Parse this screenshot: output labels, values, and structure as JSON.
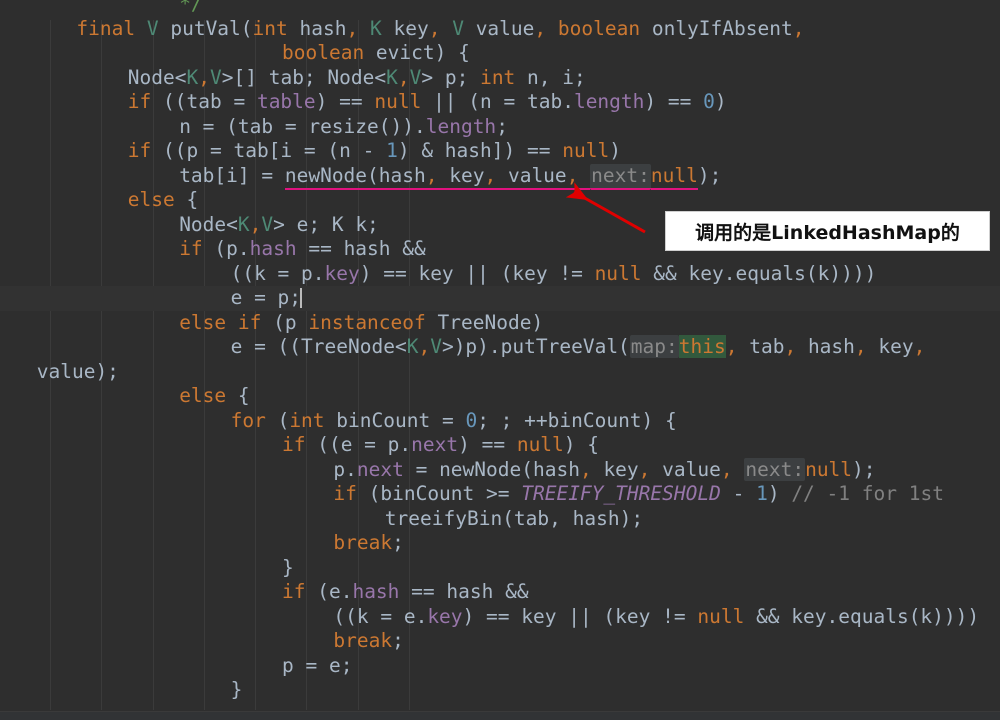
{
  "editor": {
    "language": "java",
    "theme": "darcula",
    "colors": {
      "background": "#2e2e2e",
      "foreground": "#a9b7c6",
      "keyword": "#cc7832",
      "number": "#6897bb",
      "field": "#9876aa",
      "generic_type": "#4e8975",
      "javadoc_comment": "#629755",
      "line_comment": "#808080",
      "inlay_hint_bg": "#3c3f41",
      "inlay_hint_fg": "#8a8a8a",
      "search_highlight_bg": "#32593d",
      "error_underline": "#e0127f",
      "current_line_bg": "#323232",
      "indent_guide": "#3b3b3b",
      "caret": "#bbbbbb"
    },
    "caret_line_index": 11,
    "lines": [
      {
        "indent": 3,
        "tokens": [
          {
            "t": "*/",
            "c": "cmt"
          }
        ]
      },
      {
        "indent": 1,
        "tokens": [
          {
            "t": "final",
            "c": "kw"
          },
          {
            "t": " ",
            "c": "pln"
          },
          {
            "t": "V",
            "c": "gen"
          },
          {
            "t": " ",
            "c": "pln"
          },
          {
            "t": "putVal",
            "c": "mth"
          },
          {
            "t": "(",
            "c": "punc"
          },
          {
            "t": "int",
            "c": "kw"
          },
          {
            "t": " hash",
            "c": "pln"
          },
          {
            "t": ",",
            "c": "comma"
          },
          {
            "t": " ",
            "c": "pln"
          },
          {
            "t": "K",
            "c": "gen"
          },
          {
            "t": " key",
            "c": "pln"
          },
          {
            "t": ",",
            "c": "comma"
          },
          {
            "t": " ",
            "c": "pln"
          },
          {
            "t": "V",
            "c": "gen"
          },
          {
            "t": " value",
            "c": "pln"
          },
          {
            "t": ",",
            "c": "comma"
          },
          {
            "t": " ",
            "c": "pln"
          },
          {
            "t": "boolean",
            "c": "kw"
          },
          {
            "t": " onlyIfAbsent",
            "c": "pln"
          },
          {
            "t": ",",
            "c": "comma"
          }
        ]
      },
      {
        "indent": 5,
        "tokens": [
          {
            "t": "boolean",
            "c": "kw"
          },
          {
            "t": " evict",
            "c": "pln"
          },
          {
            "t": ") {",
            "c": "punc"
          }
        ]
      },
      {
        "indent": 2,
        "tokens": [
          {
            "t": "Node<",
            "c": "typ"
          },
          {
            "t": "K",
            "c": "gen"
          },
          {
            "t": ",",
            "c": "comma"
          },
          {
            "t": "V",
            "c": "gen"
          },
          {
            "t": ">[] tab; Node<",
            "c": "typ"
          },
          {
            "t": "K",
            "c": "gen"
          },
          {
            "t": ",",
            "c": "comma"
          },
          {
            "t": "V",
            "c": "gen"
          },
          {
            "t": "> p; ",
            "c": "typ"
          },
          {
            "t": "int",
            "c": "kw"
          },
          {
            "t": " n, i;",
            "c": "pln"
          }
        ]
      },
      {
        "indent": 2,
        "tokens": [
          {
            "t": "if",
            "c": "kw"
          },
          {
            "t": " ((tab = ",
            "c": "pln"
          },
          {
            "t": "table",
            "c": "fld"
          },
          {
            "t": ") == ",
            "c": "pln"
          },
          {
            "t": "null",
            "c": "kw"
          },
          {
            "t": " || (n = tab.",
            "c": "pln"
          },
          {
            "t": "length",
            "c": "fld"
          },
          {
            "t": ") == ",
            "c": "pln"
          },
          {
            "t": "0",
            "c": "num"
          },
          {
            "t": ")",
            "c": "pln"
          }
        ]
      },
      {
        "indent": 3,
        "tokens": [
          {
            "t": "n = (tab = resize()).",
            "c": "pln"
          },
          {
            "t": "length",
            "c": "fld"
          },
          {
            "t": ";",
            "c": "pln"
          }
        ]
      },
      {
        "indent": 2,
        "tokens": [
          {
            "t": "if",
            "c": "kw"
          },
          {
            "t": " ((p = tab[i = (n - ",
            "c": "pln"
          },
          {
            "t": "1",
            "c": "num"
          },
          {
            "t": ") & hash]) == ",
            "c": "pln"
          },
          {
            "t": "null",
            "c": "kw"
          },
          {
            "t": ")",
            "c": "pln"
          }
        ]
      },
      {
        "indent": 3,
        "tokens": [
          {
            "t": "tab[i] = ",
            "c": "pln"
          },
          {
            "t": "newNode(hash",
            "c": "pln",
            "u": true
          },
          {
            "t": ",",
            "c": "comma",
            "u": true
          },
          {
            "t": " key",
            "c": "pln",
            "u": true
          },
          {
            "t": ",",
            "c": "comma",
            "u": true
          },
          {
            "t": " value",
            "c": "pln",
            "u": true
          },
          {
            "t": ",",
            "c": "comma",
            "u": true
          },
          {
            "t": " ",
            "c": "pln",
            "u": true
          },
          {
            "t": "next:",
            "c": "hint",
            "u": true
          },
          {
            "t": "null",
            "c": "kw",
            "u": true
          },
          {
            "t": ")",
            "c": "punc"
          },
          {
            "t": ";",
            "c": "pln"
          }
        ]
      },
      {
        "indent": 2,
        "tokens": [
          {
            "t": "else",
            "c": "kw"
          },
          {
            "t": " {",
            "c": "pln"
          }
        ]
      },
      {
        "indent": 3,
        "tokens": [
          {
            "t": "Node<",
            "c": "typ"
          },
          {
            "t": "K",
            "c": "gen"
          },
          {
            "t": ",",
            "c": "comma"
          },
          {
            "t": "V",
            "c": "gen"
          },
          {
            "t": "> e; K k;",
            "c": "typ"
          }
        ]
      },
      {
        "indent": 3,
        "tokens": [
          {
            "t": "if",
            "c": "kw"
          },
          {
            "t": " (p.",
            "c": "pln"
          },
          {
            "t": "hash",
            "c": "fld"
          },
          {
            "t": " == hash &&",
            "c": "pln"
          }
        ]
      },
      {
        "indent": 4,
        "tokens": [
          {
            "t": "((k = p.",
            "c": "pln"
          },
          {
            "t": "key",
            "c": "fld"
          },
          {
            "t": ") == key || (key != ",
            "c": "pln"
          },
          {
            "t": "null",
            "c": "kw"
          },
          {
            "t": " && key.equals(k))))",
            "c": "pln"
          }
        ]
      },
      {
        "indent": 4,
        "tokens": [
          {
            "t": "e = p;",
            "c": "pln"
          }
        ],
        "caret": true
      },
      {
        "indent": 3,
        "tokens": [
          {
            "t": "else",
            "c": "kw"
          },
          {
            "t": " ",
            "c": "pln"
          },
          {
            "t": "if",
            "c": "kw"
          },
          {
            "t": " (p ",
            "c": "pln"
          },
          {
            "t": "instanceof",
            "c": "kw"
          },
          {
            "t": " ",
            "c": "pln"
          },
          {
            "t": "TreeNode",
            "c": "typ"
          },
          {
            "t": ")",
            "c": "pln"
          }
        ]
      },
      {
        "indent": 4,
        "tokens": [
          {
            "t": "e = ((TreeNode<",
            "c": "pln"
          },
          {
            "t": "K",
            "c": "gen"
          },
          {
            "t": ",",
            "c": "comma"
          },
          {
            "t": "V",
            "c": "gen"
          },
          {
            "t": ">)p).putTreeVal(",
            "c": "pln"
          },
          {
            "t": "map:",
            "c": "hint"
          },
          {
            "t": "this",
            "c": "searchhit"
          },
          {
            "t": ",",
            "c": "comma"
          },
          {
            "t": " tab",
            "c": "pln"
          },
          {
            "t": ",",
            "c": "comma"
          },
          {
            "t": " hash",
            "c": "pln"
          },
          {
            "t": ",",
            "c": "comma"
          },
          {
            "t": " key",
            "c": "pln"
          },
          {
            "t": ",",
            "c": "comma"
          }
        ]
      },
      {
        "indent": 0,
        "tokens": [
          {
            "t": " value);",
            "c": "pln"
          }
        ],
        "wrapped": true
      },
      {
        "indent": 3,
        "tokens": [
          {
            "t": "else",
            "c": "kw"
          },
          {
            "t": " {",
            "c": "pln"
          }
        ]
      },
      {
        "indent": 4,
        "tokens": [
          {
            "t": "for",
            "c": "kw"
          },
          {
            "t": " (",
            "c": "pln"
          },
          {
            "t": "int",
            "c": "kw"
          },
          {
            "t": " binCount = ",
            "c": "pln"
          },
          {
            "t": "0",
            "c": "num"
          },
          {
            "t": "; ; ++binCount) {",
            "c": "pln"
          }
        ]
      },
      {
        "indent": 5,
        "tokens": [
          {
            "t": "if",
            "c": "kw"
          },
          {
            "t": " ((e = p.",
            "c": "pln"
          },
          {
            "t": "next",
            "c": "fld"
          },
          {
            "t": ") == ",
            "c": "pln"
          },
          {
            "t": "null",
            "c": "kw"
          },
          {
            "t": ") {",
            "c": "pln"
          }
        ]
      },
      {
        "indent": 6,
        "tokens": [
          {
            "t": "p.",
            "c": "pln"
          },
          {
            "t": "next",
            "c": "fld"
          },
          {
            "t": " = newNode(hash",
            "c": "pln"
          },
          {
            "t": ",",
            "c": "comma"
          },
          {
            "t": " key",
            "c": "pln"
          },
          {
            "t": ",",
            "c": "comma"
          },
          {
            "t": " value",
            "c": "pln"
          },
          {
            "t": ",",
            "c": "comma"
          },
          {
            "t": " ",
            "c": "pln"
          },
          {
            "t": "next:",
            "c": "hint"
          },
          {
            "t": "null",
            "c": "kw"
          },
          {
            "t": ");",
            "c": "pln"
          }
        ]
      },
      {
        "indent": 6,
        "tokens": [
          {
            "t": "if",
            "c": "kw"
          },
          {
            "t": " (binCount >= ",
            "c": "pln"
          },
          {
            "t": "TREEIFY_THRESHOLD",
            "c": "sfld"
          },
          {
            "t": " - ",
            "c": "pln"
          },
          {
            "t": "1",
            "c": "num"
          },
          {
            "t": ") ",
            "c": "pln"
          },
          {
            "t": "// -1 for 1st",
            "c": "lcmt"
          }
        ]
      },
      {
        "indent": 7,
        "tokens": [
          {
            "t": "treeifyBin(tab, hash);",
            "c": "pln"
          }
        ]
      },
      {
        "indent": 6,
        "tokens": [
          {
            "t": "break",
            "c": "kw"
          },
          {
            "t": ";",
            "c": "pln"
          }
        ]
      },
      {
        "indent": 5,
        "tokens": [
          {
            "t": "}",
            "c": "pln"
          }
        ]
      },
      {
        "indent": 5,
        "tokens": [
          {
            "t": "if",
            "c": "kw"
          },
          {
            "t": " (e.",
            "c": "pln"
          },
          {
            "t": "hash",
            "c": "fld"
          },
          {
            "t": " == hash &&",
            "c": "pln"
          }
        ]
      },
      {
        "indent": 6,
        "tokens": [
          {
            "t": "((k = e.",
            "c": "pln"
          },
          {
            "t": "key",
            "c": "fld"
          },
          {
            "t": ") == key || (key != ",
            "c": "pln"
          },
          {
            "t": "null",
            "c": "kw"
          },
          {
            "t": " && key.equals(k))))",
            "c": "pln"
          }
        ]
      },
      {
        "indent": 6,
        "tokens": [
          {
            "t": "break",
            "c": "kw"
          },
          {
            "t": ";",
            "c": "pln"
          }
        ]
      },
      {
        "indent": 5,
        "tokens": [
          {
            "t": "p = e;",
            "c": "pln"
          }
        ]
      },
      {
        "indent": 4,
        "tokens": [
          {
            "t": "}",
            "c": "pln"
          }
        ]
      }
    ],
    "indent_guide_x": [
      50,
      101,
      153,
      204,
      255,
      306,
      358,
      409
    ]
  },
  "annotation": {
    "text": "调用的是LinkedHashMap的",
    "box_color": "#ffffff",
    "text_color": "#111111",
    "arrow_color": "#e00000"
  }
}
